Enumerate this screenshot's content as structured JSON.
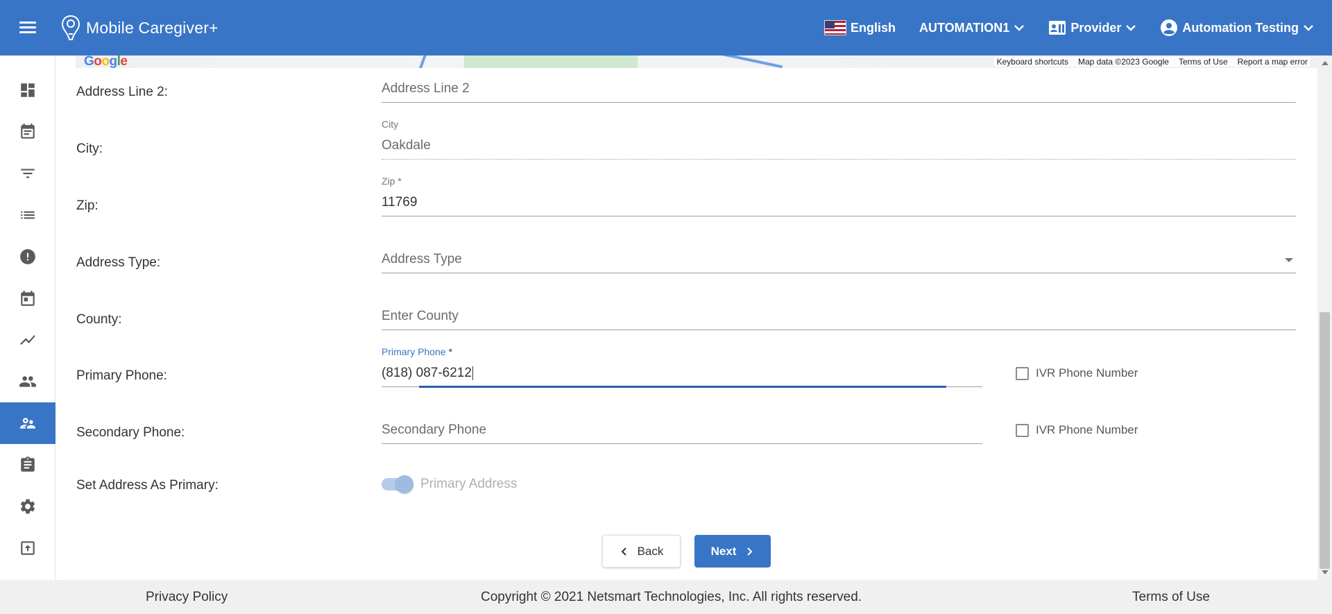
{
  "app": {
    "title": "Mobile Caregiver+",
    "language": "English",
    "agency": "AUTOMATION1",
    "role": "Provider",
    "user": "Automation Testing",
    "accent_color": "#3875c6"
  },
  "sidebar": {
    "items": [
      {
        "icon": "dashboard-icon"
      },
      {
        "icon": "calendar-note-icon"
      },
      {
        "icon": "filter-icon"
      },
      {
        "icon": "list-icon"
      },
      {
        "icon": "alert-icon"
      },
      {
        "icon": "calendar-icon"
      },
      {
        "icon": "trending-icon"
      },
      {
        "icon": "people-icon"
      },
      {
        "icon": "clients-icon",
        "active": true
      },
      {
        "icon": "clipboard-icon"
      },
      {
        "icon": "settings-icon"
      },
      {
        "icon": "upload-icon"
      }
    ]
  },
  "map": {
    "logo": "Google",
    "attribution": [
      "Keyboard shortcuts",
      "Map data ©2023 Google",
      "Terms of Use",
      "Report a map error"
    ]
  },
  "form": {
    "address_line2": {
      "label": "Address Line 2:",
      "placeholder": "Address Line 2",
      "value": ""
    },
    "city": {
      "label": "City:",
      "float_label": "City",
      "value": "Oakdale"
    },
    "zip": {
      "label": "Zip:",
      "float_label": "Zip *",
      "value": "11769"
    },
    "address_type": {
      "label": "Address Type:",
      "placeholder": "Address Type",
      "value": ""
    },
    "county": {
      "label": "County:",
      "placeholder": "Enter County",
      "value": ""
    },
    "primary_phone": {
      "label": "Primary Phone:",
      "float_label": "Primary Phone",
      "required_mark": " *",
      "value": "(818) 087-6212",
      "ivr_label": "IVR Phone Number",
      "ivr_checked": false
    },
    "secondary_phone": {
      "label": "Secondary Phone:",
      "placeholder": "Secondary Phone",
      "value": "",
      "ivr_label": "IVR Phone Number",
      "ivr_checked": false
    },
    "set_primary": {
      "label": "Set Address As Primary:",
      "toggle_label": "Primary Address",
      "toggle_on": true,
      "disabled": true
    }
  },
  "actions": {
    "back": "Back",
    "next": "Next"
  },
  "footer": {
    "privacy": "Privacy Policy",
    "copyright": "Copyright © 2021 Netsmart Technologies, Inc. All rights reserved.",
    "terms": "Terms of Use"
  }
}
